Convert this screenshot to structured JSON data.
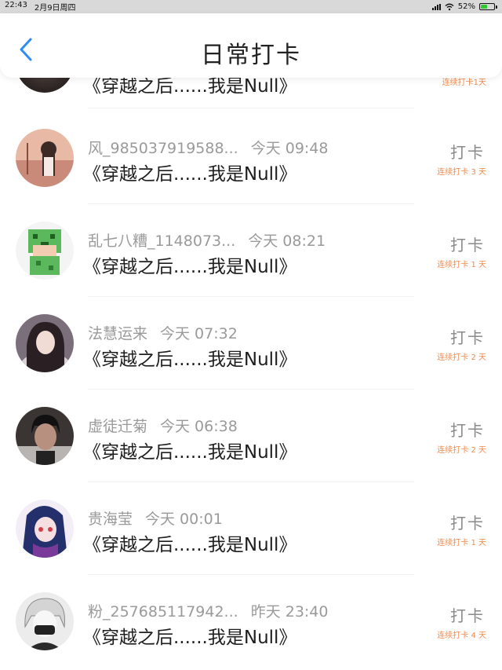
{
  "status_bar": {
    "time": "22:43",
    "date": "2月9日周四",
    "battery": "52%",
    "battery_level": 0.52
  },
  "header": {
    "title": "日常打卡"
  },
  "partial_row": {
    "book": "《穿越之后......我是Null》",
    "streak": "连续打卡1天"
  },
  "items": [
    {
      "name": "风_985037919588...",
      "time": "今天 09:48",
      "book": "《穿越之后......我是Null》",
      "action": "打卡",
      "streak": "连续打卡 3 天"
    },
    {
      "name": "乱七八糟_1148073...",
      "time": "今天 08:21",
      "book": "《穿越之后......我是Null》",
      "action": "打卡",
      "streak": "连续打卡 1 天"
    },
    {
      "name": "法慧运来",
      "time": "今天 07:32",
      "book": "《穿越之后......我是Null》",
      "action": "打卡",
      "streak": "连续打卡 2 天"
    },
    {
      "name": "虚徒迁菊",
      "time": "今天 06:38",
      "book": "《穿越之后......我是Null》",
      "action": "打卡",
      "streak": "连续打卡 2 天"
    },
    {
      "name": "贵海莹",
      "time": "今天 00:01",
      "book": "《穿越之后......我是Null》",
      "action": "打卡",
      "streak": "连续打卡 1 天"
    },
    {
      "name": "粉_257685117942...",
      "time": "昨天 23:40",
      "book": "《穿越之后......我是Null》",
      "action": "打卡",
      "streak": "连续打卡 4 天"
    }
  ],
  "colors": {
    "accent_blue": "#2f8cf5",
    "streak_orange": "#f08a4b",
    "battery_green": "#32c832"
  }
}
